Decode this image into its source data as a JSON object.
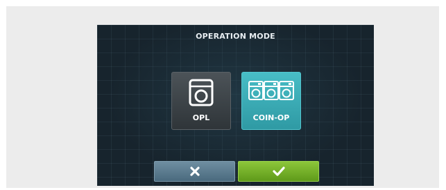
{
  "header": {
    "title": "OPERATION MODE"
  },
  "modes": [
    {
      "label": "OPL",
      "icon": "washer-icon",
      "selected": false
    },
    {
      "label": "COIN-OP",
      "icon": "coin-washers-icon",
      "selected": true
    }
  ],
  "actions": {
    "cancel": {
      "icon": "close-icon"
    },
    "confirm": {
      "icon": "check-icon"
    }
  },
  "colors": {
    "screen_bg": "#17242d",
    "opl_button": "#3d4449",
    "coin_button_selected": "#3aa9b3",
    "cancel_button": "#5b7a8e",
    "confirm_button": "#79b32a"
  }
}
